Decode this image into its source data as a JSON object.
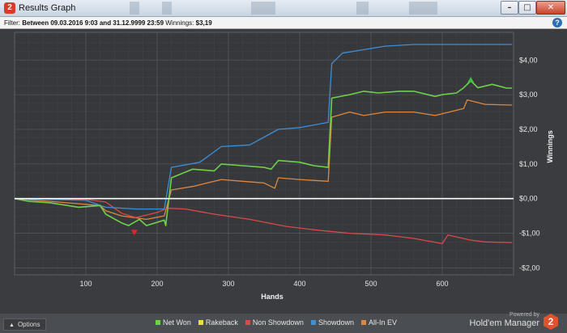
{
  "window": {
    "title": "Results Graph",
    "app_icon_glyph": "2",
    "controls": {
      "minimize": "–",
      "maximize": "□",
      "close": "✕"
    }
  },
  "filter": {
    "prefix": "Filter:",
    "between_text": "Between 09.03.2016 9:03 and 31.12.9999 23:59",
    "winnings_label": "Winnings:",
    "winnings_value": "$3,19",
    "help_glyph": "?"
  },
  "options_button": {
    "label": "Options",
    "chevron": "▲"
  },
  "branding": {
    "powered_by": "Powered by",
    "name": "Hold'em Manager",
    "logo_glyph": "2"
  },
  "colors": {
    "background": "#3a3c40",
    "plot_bg": "#36383c",
    "grid": "#55585d",
    "zero_line": "#ffffff",
    "net_won": "#6fd14a",
    "rakeback": "#e8e23a",
    "non_showdown": "#d94a48",
    "showdown": "#3d8fd6",
    "all_in_ev": "#e0873e"
  },
  "chart_data": {
    "type": "line",
    "xlabel": "Hands",
    "ylabel": "Winnings",
    "xlim": [
      0,
      700
    ],
    "ylim": [
      -2.2,
      4.8
    ],
    "x_ticks": [
      100,
      200,
      300,
      400,
      500,
      600
    ],
    "y_ticks": [
      {
        "value": 4,
        "label": "$4,00"
      },
      {
        "value": 3,
        "label": "$3,00"
      },
      {
        "value": 2,
        "label": "$2,00"
      },
      {
        "value": 1,
        "label": "$1,00"
      },
      {
        "value": 0,
        "label": "$0,00"
      },
      {
        "value": -1,
        "label": "-$1,00"
      },
      {
        "value": -2,
        "label": "-$2,00"
      }
    ],
    "grid": true,
    "legend_position": "bottom",
    "series": [
      {
        "name": "Net Won",
        "color": "#6fd14a",
        "points": [
          [
            0,
            0
          ],
          [
            20,
            -0.08
          ],
          [
            50,
            -0.12
          ],
          [
            90,
            -0.25
          ],
          [
            120,
            -0.2
          ],
          [
            128,
            -0.45
          ],
          [
            150,
            -0.7
          ],
          [
            160,
            -0.78
          ],
          [
            175,
            -0.6
          ],
          [
            185,
            -0.78
          ],
          [
            210,
            -0.62
          ],
          [
            212,
            -0.78
          ],
          [
            220,
            0.6
          ],
          [
            250,
            0.85
          ],
          [
            280,
            0.8
          ],
          [
            290,
            1.0
          ],
          [
            320,
            0.95
          ],
          [
            350,
            0.9
          ],
          [
            360,
            0.85
          ],
          [
            370,
            1.1
          ],
          [
            400,
            1.05
          ],
          [
            420,
            0.95
          ],
          [
            440,
            0.9
          ],
          [
            445,
            2.9
          ],
          [
            470,
            3.0
          ],
          [
            490,
            3.1
          ],
          [
            510,
            3.05
          ],
          [
            540,
            3.1
          ],
          [
            560,
            3.1
          ],
          [
            590,
            2.95
          ],
          [
            600,
            3.0
          ],
          [
            620,
            3.05
          ],
          [
            630,
            3.2
          ],
          [
            640,
            3.4
          ],
          [
            650,
            3.2
          ],
          [
            670,
            3.3
          ],
          [
            690,
            3.19
          ],
          [
            698,
            3.19
          ]
        ]
      },
      {
        "name": "Rakeback",
        "color": "#e8e23a",
        "points": [
          [
            0,
            0
          ],
          [
            698,
            0
          ]
        ]
      },
      {
        "name": "Non Showdown",
        "color": "#d94a48",
        "points": [
          [
            0,
            0
          ],
          [
            100,
            -0.02
          ],
          [
            128,
            -0.1
          ],
          [
            150,
            -0.42
          ],
          [
            170,
            -0.55
          ],
          [
            200,
            -0.4
          ],
          [
            215,
            -0.28
          ],
          [
            240,
            -0.3
          ],
          [
            280,
            -0.45
          ],
          [
            330,
            -0.6
          ],
          [
            380,
            -0.8
          ],
          [
            420,
            -0.9
          ],
          [
            470,
            -1.0
          ],
          [
            520,
            -1.05
          ],
          [
            560,
            -1.15
          ],
          [
            600,
            -1.3
          ],
          [
            608,
            -1.05
          ],
          [
            640,
            -1.2
          ],
          [
            660,
            -1.25
          ],
          [
            698,
            -1.27
          ]
        ]
      },
      {
        "name": "Showdown",
        "color": "#3d8fd6",
        "points": [
          [
            0,
            0
          ],
          [
            100,
            -0.05
          ],
          [
            128,
            -0.25
          ],
          [
            170,
            -0.3
          ],
          [
            210,
            -0.3
          ],
          [
            220,
            0.9
          ],
          [
            260,
            1.05
          ],
          [
            290,
            1.5
          ],
          [
            330,
            1.55
          ],
          [
            370,
            2.0
          ],
          [
            400,
            2.05
          ],
          [
            440,
            2.2
          ],
          [
            445,
            3.9
          ],
          [
            460,
            4.2
          ],
          [
            490,
            4.3
          ],
          [
            520,
            4.4
          ],
          [
            560,
            4.45
          ],
          [
            600,
            4.45
          ],
          [
            698,
            4.45
          ]
        ]
      },
      {
        "name": "All-In EV",
        "color": "#e0873e",
        "points": [
          [
            0,
            0
          ],
          [
            50,
            -0.08
          ],
          [
            90,
            -0.15
          ],
          [
            120,
            -0.2
          ],
          [
            128,
            -0.35
          ],
          [
            150,
            -0.5
          ],
          [
            185,
            -0.6
          ],
          [
            210,
            -0.5
          ],
          [
            220,
            0.25
          ],
          [
            250,
            0.35
          ],
          [
            290,
            0.55
          ],
          [
            320,
            0.5
          ],
          [
            350,
            0.45
          ],
          [
            365,
            0.3
          ],
          [
            370,
            0.6
          ],
          [
            400,
            0.55
          ],
          [
            440,
            0.5
          ],
          [
            445,
            2.35
          ],
          [
            470,
            2.5
          ],
          [
            490,
            2.4
          ],
          [
            520,
            2.5
          ],
          [
            560,
            2.5
          ],
          [
            590,
            2.4
          ],
          [
            630,
            2.6
          ],
          [
            635,
            2.85
          ],
          [
            660,
            2.72
          ],
          [
            698,
            2.7
          ]
        ]
      }
    ],
    "markers": [
      {
        "name": "max-marker",
        "x": 640,
        "y": 3.4,
        "direction": "up",
        "color": "#3fbf3f"
      },
      {
        "name": "min-marker",
        "x": 168,
        "y": -0.95,
        "direction": "down",
        "color": "#e0242a"
      }
    ]
  }
}
